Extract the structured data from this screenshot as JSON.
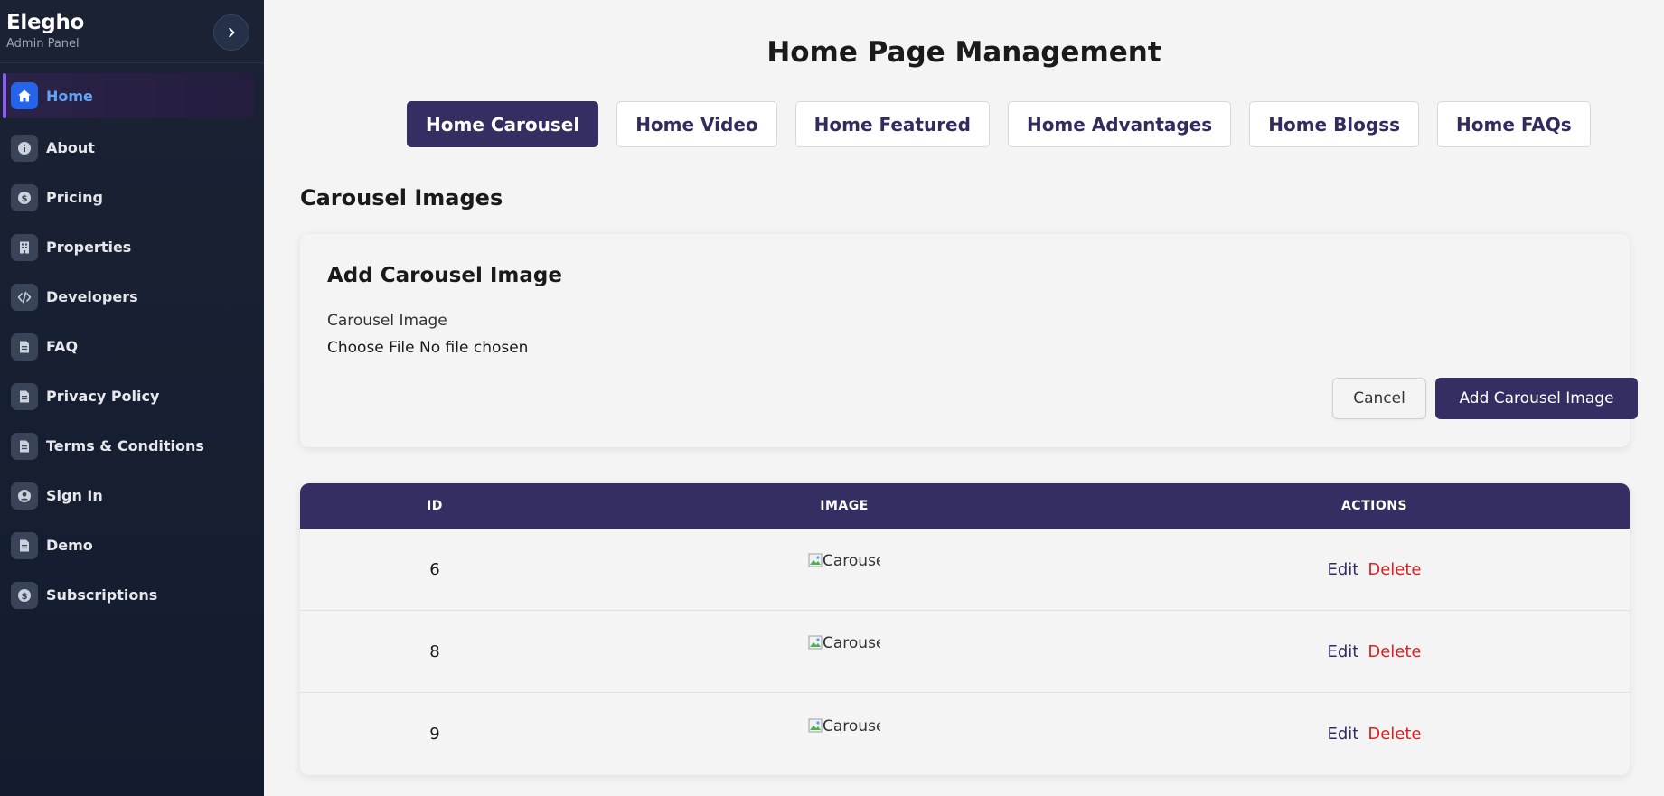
{
  "brand": {
    "name": "Elegho",
    "subtitle": "Admin Panel"
  },
  "sidebar": {
    "items": [
      {
        "label": "Home",
        "icon": "home-icon",
        "active": true
      },
      {
        "label": "About",
        "icon": "info-icon"
      },
      {
        "label": "Pricing",
        "icon": "dollar-icon"
      },
      {
        "label": "Properties",
        "icon": "building-icon"
      },
      {
        "label": "Developers",
        "icon": "code-icon"
      },
      {
        "label": "FAQ",
        "icon": "document-icon"
      },
      {
        "label": "Privacy Policy",
        "icon": "document-icon"
      },
      {
        "label": "Terms & Conditions",
        "icon": "document-icon"
      },
      {
        "label": "Sign In",
        "icon": "user-circle-icon"
      },
      {
        "label": "Demo",
        "icon": "document-icon"
      },
      {
        "label": "Subscriptions",
        "icon": "dollar-icon"
      }
    ]
  },
  "main": {
    "title": "Home Page Management",
    "tabs": [
      {
        "label": "Home Carousel",
        "active": true
      },
      {
        "label": "Home Video"
      },
      {
        "label": "Home Featured"
      },
      {
        "label": "Home Advantages"
      },
      {
        "label": "Home Blogss"
      },
      {
        "label": "Home FAQs"
      }
    ],
    "section_title": "Carousel Images",
    "form": {
      "title": "Add Carousel Image",
      "field_label": "Carousel Image",
      "file_button": "Choose File",
      "file_status": "No file chosen",
      "cancel_label": "Cancel",
      "submit_label": "Add Carousel Image"
    },
    "table": {
      "headers": [
        "ID",
        "IMAGE",
        "ACTIONS"
      ],
      "rows": [
        {
          "id": "6",
          "image_alt": "Carousel"
        },
        {
          "id": "8",
          "image_alt": "Carousel"
        },
        {
          "id": "9",
          "image_alt": "Carousel"
        }
      ],
      "edit_label": "Edit",
      "delete_label": "Delete"
    }
  },
  "colors": {
    "sidebar_bg": "#131b2e",
    "primary": "#342e63",
    "active_icon": "#2563eb",
    "active_label": "#60a5fa",
    "accent_bar": "#8b5cf6",
    "delete": "#dc1f1f"
  }
}
